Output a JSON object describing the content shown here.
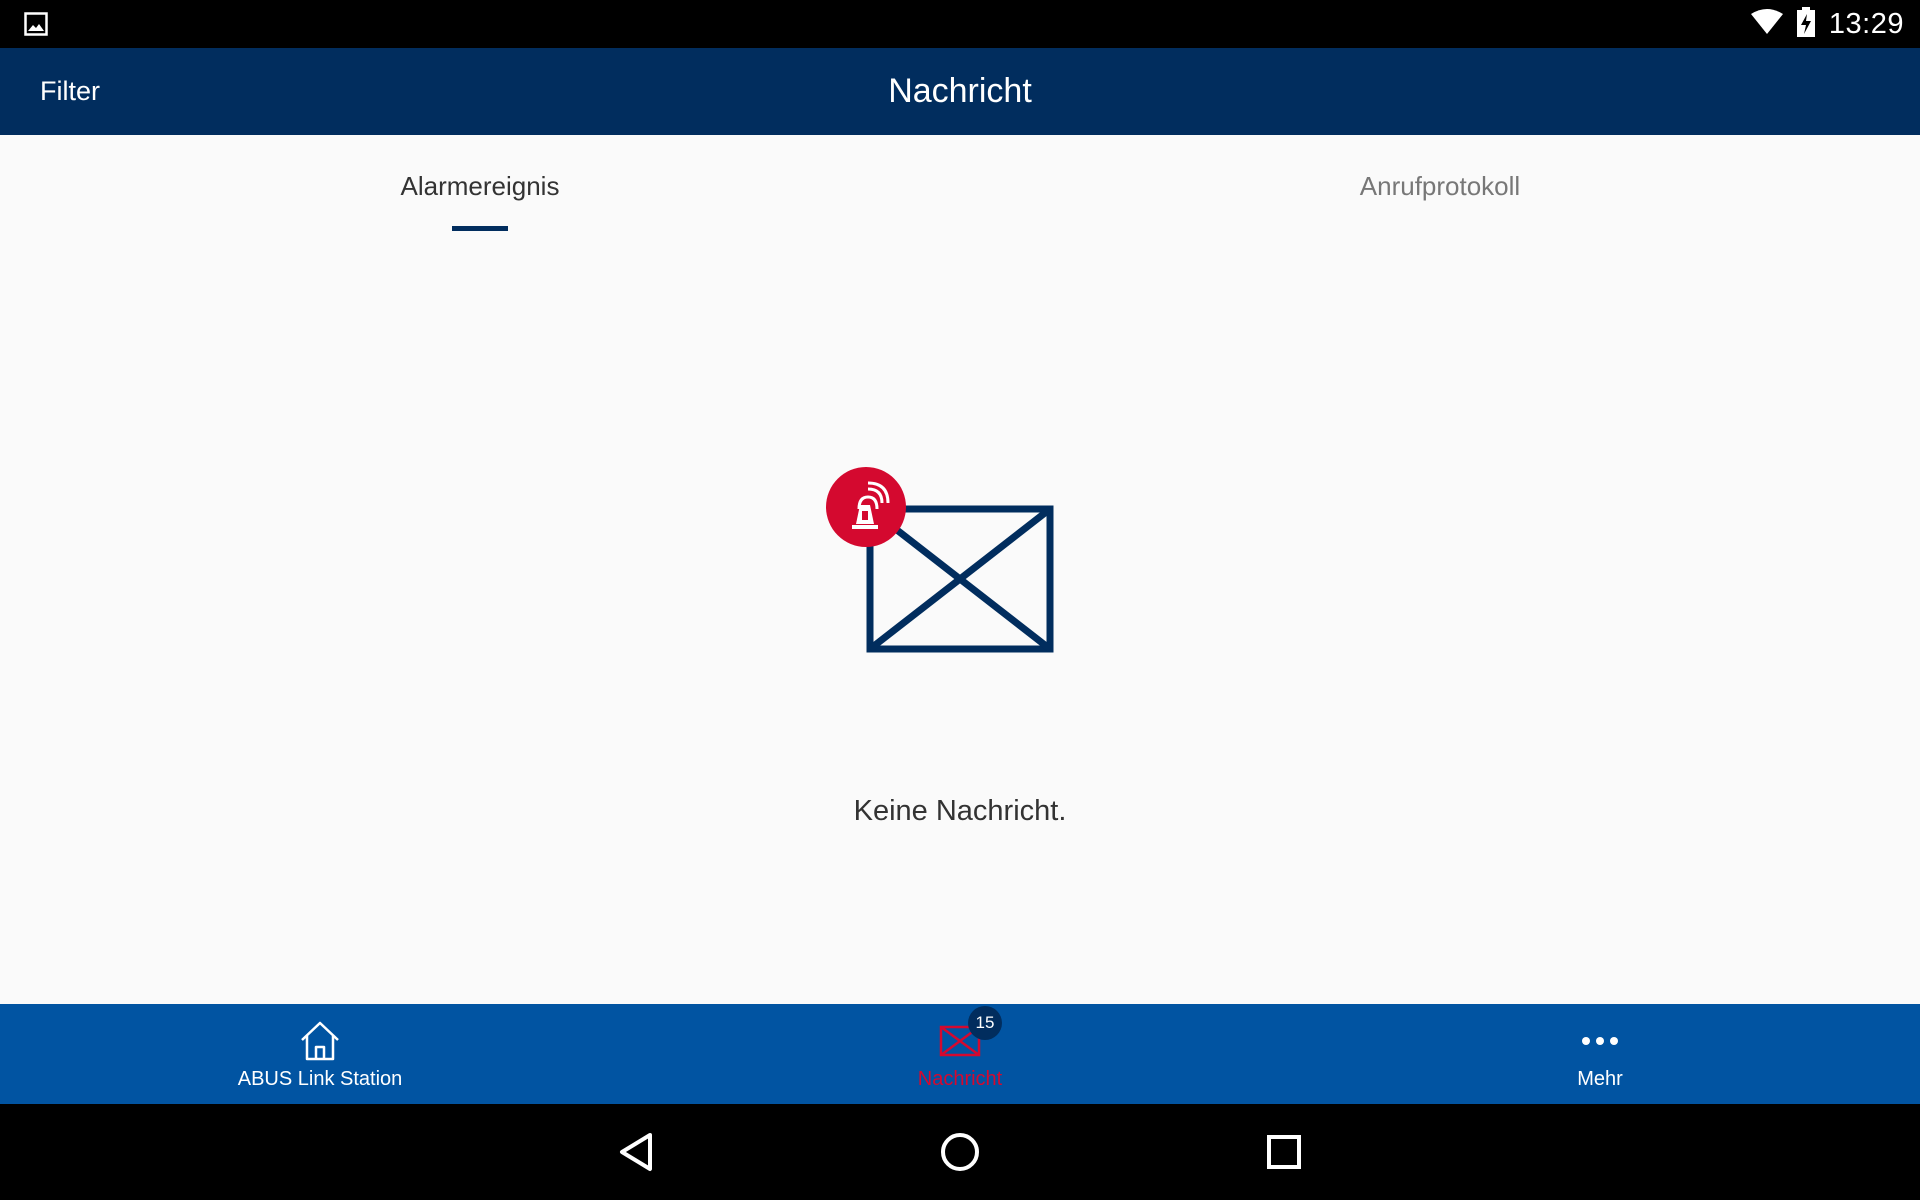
{
  "status_bar": {
    "time": "13:29",
    "icons": [
      "gallery-icon",
      "wifi-icon",
      "battery-charging-icon"
    ]
  },
  "app_bar": {
    "filter_label": "Filter",
    "title": "Nachricht"
  },
  "tabs": [
    {
      "label": "Alarmereignis",
      "active": true
    },
    {
      "label": "Anrufprotokoll",
      "active": false
    }
  ],
  "empty_state": {
    "message": "Keine Nachricht.",
    "icon": "alarm-envelope-icon"
  },
  "bottom_nav": {
    "items": [
      {
        "label": "ABUS Link Station",
        "icon": "home-icon",
        "active": false
      },
      {
        "label": "Nachricht",
        "icon": "envelope-icon",
        "active": true,
        "badge": "15"
      },
      {
        "label": "Mehr",
        "icon": "more-dots-icon",
        "active": false
      }
    ]
  },
  "system_nav": {
    "icons": [
      "back-icon",
      "home-circle-icon",
      "recents-icon"
    ]
  },
  "colors": {
    "app_bar": "#012d5e",
    "bottom_nav": "#0154a2",
    "accent_red": "#d4092f",
    "background": "#fafafa"
  }
}
